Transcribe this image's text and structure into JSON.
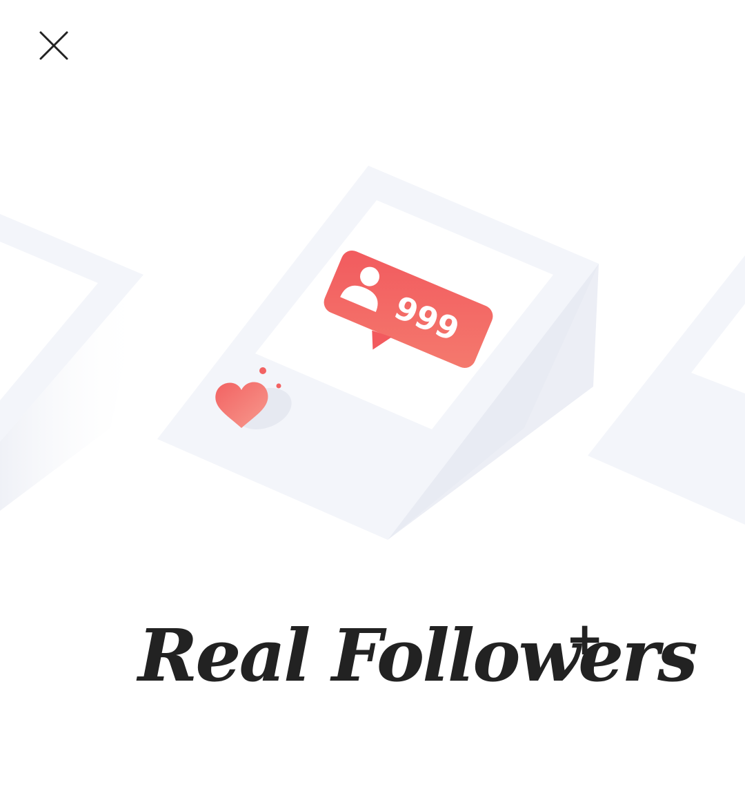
{
  "header": {
    "close_icon": "close-icon"
  },
  "illustration": {
    "badge": {
      "icon": "user-icon",
      "count": "999",
      "color": "#f15b5b"
    },
    "heart": {
      "icon": "heart-icon",
      "color": "#f26565"
    }
  },
  "promo": {
    "title": "Real Followers",
    "title_suffix": "+"
  }
}
